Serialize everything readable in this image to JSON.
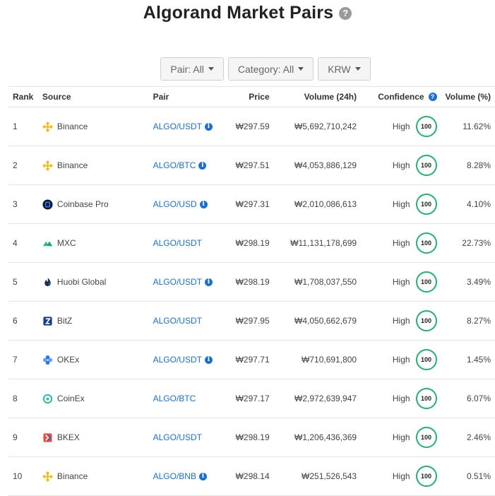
{
  "header": {
    "title": "Algorand Market Pairs",
    "help_icon": "?"
  },
  "filters": [
    {
      "label": "Pair: All"
    },
    {
      "label": "Category: All"
    },
    {
      "label": "KRW"
    }
  ],
  "table": {
    "columns": {
      "rank": "Rank",
      "source": "Source",
      "pair": "Pair",
      "price": "Price",
      "volume": "Volume (24h)",
      "confidence": "Confidence",
      "volume_pct": "Volume (%)"
    },
    "rows": [
      {
        "rank": "1",
        "exchange": "Binance",
        "icon": "binance",
        "pair": "ALGO/USDT",
        "info": true,
        "price": "₩297.59",
        "volume": "₩5,692,710,242",
        "confidence": "High",
        "score": "100",
        "pct": "11.62%"
      },
      {
        "rank": "2",
        "exchange": "Binance",
        "icon": "binance",
        "pair": "ALGO/BTC",
        "info": true,
        "price": "₩297.51",
        "volume": "₩4,053,886,129",
        "confidence": "High",
        "score": "100",
        "pct": "8.28%"
      },
      {
        "rank": "3",
        "exchange": "Coinbase Pro",
        "icon": "coinbase",
        "pair": "ALGO/USD",
        "info": true,
        "price": "₩297.31",
        "volume": "₩2,010,086,613",
        "confidence": "High",
        "score": "100",
        "pct": "4.10%"
      },
      {
        "rank": "4",
        "exchange": "MXC",
        "icon": "mxc",
        "pair": "ALGO/USDT",
        "info": false,
        "price": "₩298.19",
        "volume": "₩11,131,178,699",
        "confidence": "High",
        "score": "100",
        "pct": "22.73%"
      },
      {
        "rank": "5",
        "exchange": "Huobi Global",
        "icon": "huobi",
        "pair": "ALGO/USDT",
        "info": true,
        "price": "₩298.19",
        "volume": "₩1,708,037,550",
        "confidence": "High",
        "score": "100",
        "pct": "3.49%"
      },
      {
        "rank": "6",
        "exchange": "BitZ",
        "icon": "bitz",
        "pair": "ALGO/USDT",
        "info": false,
        "price": "₩297.95",
        "volume": "₩4,050,662,679",
        "confidence": "High",
        "score": "100",
        "pct": "8.27%"
      },
      {
        "rank": "7",
        "exchange": "OKEx",
        "icon": "okex",
        "pair": "ALGO/USDT",
        "info": true,
        "price": "₩297.71",
        "volume": "₩710,691,800",
        "confidence": "High",
        "score": "100",
        "pct": "1.45%"
      },
      {
        "rank": "8",
        "exchange": "CoinEx",
        "icon": "coinex",
        "pair": "ALGO/BTC",
        "info": false,
        "price": "₩297.17",
        "volume": "₩2,972,639,947",
        "confidence": "High",
        "score": "100",
        "pct": "6.07%"
      },
      {
        "rank": "9",
        "exchange": "BKEX",
        "icon": "bkex",
        "pair": "ALGO/USDT",
        "info": false,
        "price": "₩298.19",
        "volume": "₩1,206,436,369",
        "confidence": "High",
        "score": "100",
        "pct": "2.46%"
      },
      {
        "rank": "10",
        "exchange": "Binance",
        "icon": "binance",
        "pair": "ALGO/BNB",
        "info": true,
        "price": "₩298.14",
        "volume": "₩251,526,543",
        "confidence": "High",
        "score": "100",
        "pct": "0.51%"
      }
    ]
  },
  "colors": {
    "link": "#1a6fd1",
    "confidence_ring": "#21b36f"
  }
}
